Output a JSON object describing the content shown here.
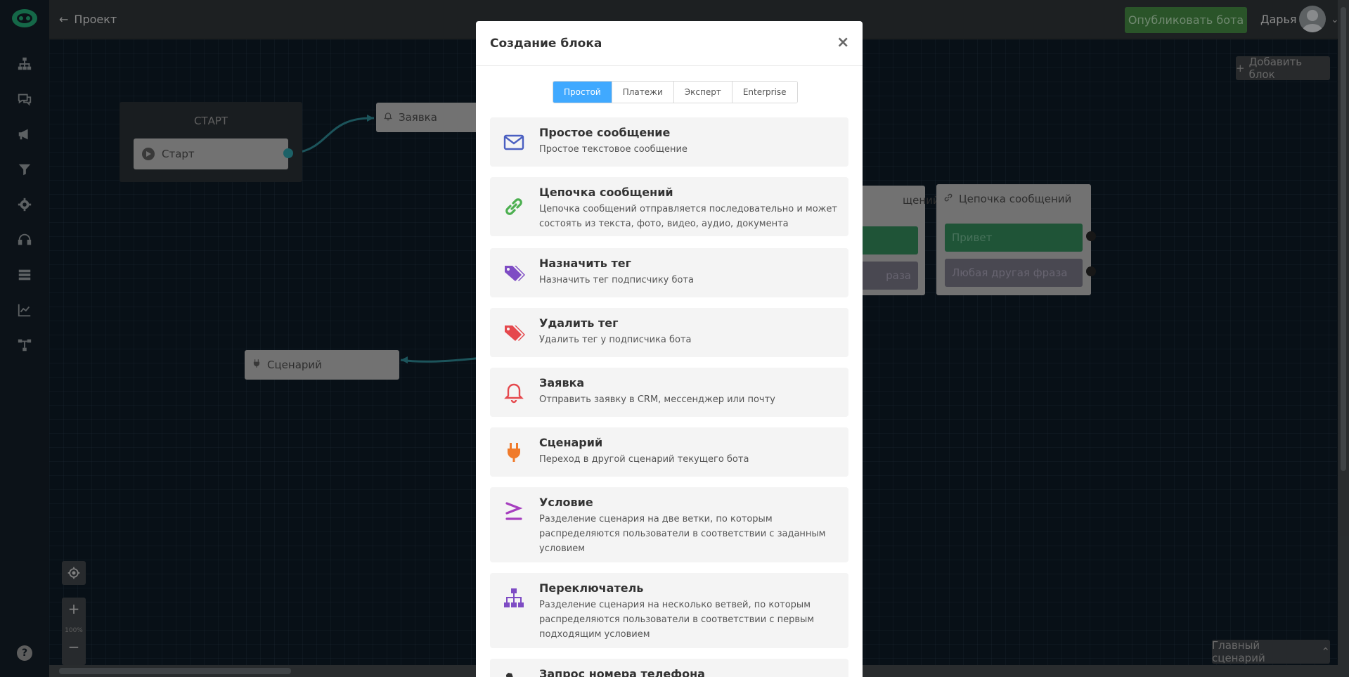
{
  "topbar": {
    "back_label": "Проект",
    "publish_label": "Опубликовать бота",
    "user_name": "Дарья"
  },
  "canvas": {
    "add_block_label": "Добавить блок",
    "start_group_title": "СТАРТ",
    "start_node_label": "Старт",
    "request_node_label": "Заявка",
    "scenario_node_label": "Сценарий",
    "chain_partial_title": "щений",
    "chain_partial_gray": "раза",
    "chain_title": "Цепочка сообщений",
    "chain_btn_hello": "Привет",
    "chain_btn_other": "Любая другая фраза",
    "zoom_level": "100%",
    "scenario_switch_label": "Главный сценарий"
  },
  "modal": {
    "title": "Создание блока",
    "close_symbol": "×",
    "tabs": [
      {
        "label": "Простой",
        "active": true
      },
      {
        "label": "Платежи",
        "active": false
      },
      {
        "label": "Эксперт",
        "active": false
      },
      {
        "label": "Enterprise",
        "active": false
      }
    ],
    "items": [
      {
        "title": "Простое сообщение",
        "desc": "Простое текстовое сообщение",
        "icon": "envelope-icon",
        "color": "#4a5fc1"
      },
      {
        "title": "Цепочка сообщений",
        "desc": "Цепочка сообщений отправляется последовательно и может состоять из текста, фото, видео, аудио, документа",
        "icon": "link-icon",
        "color": "#4caf50"
      },
      {
        "title": "Назначить тег",
        "desc": "Назначить тег подписчику бота",
        "icon": "tags-icon",
        "color": "#7e4cc4"
      },
      {
        "title": "Удалить тег",
        "desc": "Удалить тег у подписчика бота",
        "icon": "tags-icon",
        "color": "#e5484d"
      },
      {
        "title": "Заявка",
        "desc": "Отправить заявку в CRM, мессенджер или почту",
        "icon": "bell-icon",
        "color": "#e5484d"
      },
      {
        "title": "Сценарий",
        "desc": "Переход в другой сценарий текущего бота",
        "icon": "plug-icon",
        "color": "#f07a2a"
      },
      {
        "title": "Условие",
        "desc": "Разделение сценария на две ветки, по которым распределяются пользователи в соответствии с заданным условием",
        "icon": "greater-equal-icon",
        "color": "#a63fbf"
      },
      {
        "title": "Переключатель",
        "desc": "Разделение сценария на несколько ветвей, по которым распределяются пользователи в соответствии с первым подходящим условием",
        "icon": "sitemap-icon",
        "color": "#7e4cc4"
      },
      {
        "title": "Запрос номера телефона",
        "desc": "",
        "icon": "phone-icon",
        "color": "#333333"
      }
    ]
  }
}
